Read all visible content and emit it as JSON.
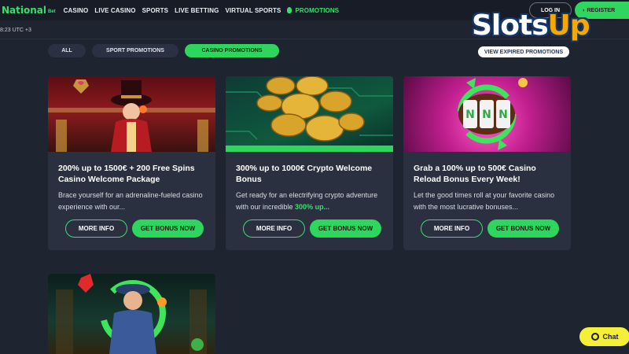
{
  "brand": {
    "name": "National",
    "sub": "Bet"
  },
  "nav": {
    "items": [
      "CASINO",
      "LIVE CASINO",
      "SPORTS",
      "LIVE BETTING",
      "VIRTUAL SPORTS"
    ],
    "promotions": "PROMOTIONS"
  },
  "auth": {
    "login": "LOG IN",
    "register": "REGISTER"
  },
  "clock": "8:23 UTC +3",
  "tabs": [
    "ALL",
    "SPORT PROMOTIONS",
    "CASINO PROMOTIONS"
  ],
  "watermark": {
    "text_a": "Slots",
    "text_b": "Up",
    "expired": "VIEW EXPIRED PROMOTIONS"
  },
  "cards": [
    {
      "title": "200% up to 1500€ + 200 Free Spins Casino Welcome Package",
      "desc": "Brace yourself for an adrenaline-fueled casino experience with our...",
      "desc_highlight": "",
      "more": "MORE INFO",
      "get": "GET BONUS NOW"
    },
    {
      "title": "300% up to 1000€ Crypto Welcome Bonus",
      "desc": "Get ready for an electrifying crypto adventure with our incredible ",
      "desc_highlight": "300% up...",
      "more": "MORE INFO",
      "get": "GET BONUS NOW"
    },
    {
      "title": "Grab a 100% up to 500€ Casino Reload Bonus Every Week!",
      "desc": "Let the good times roll at your favorite casino with the most lucrative bonuses...",
      "desc_highlight": "",
      "more": "MORE INFO",
      "get": "GET BONUS NOW"
    }
  ],
  "chat": "Chat",
  "colors": {
    "accent": "#2fd65d",
    "bg": "#1f2431",
    "card": "#2a3040",
    "chat": "#f4f03a"
  }
}
